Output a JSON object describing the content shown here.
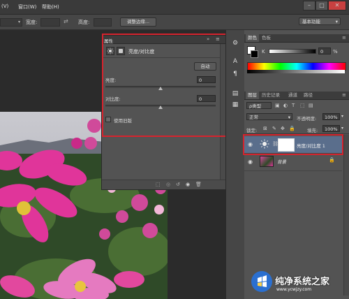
{
  "menubar": {
    "items": [
      "(V)",
      "窗口(W)",
      "帮助(H)"
    ],
    "window_buttons": [
      "–",
      "□",
      "✕"
    ]
  },
  "options_bar": {
    "width_label": "宽度:",
    "height_label": "高度:",
    "refine_edge_label": "调整边缘...",
    "workspace_label": "基本功能",
    "swap_icon": "swap-arrows-icon"
  },
  "properties_panel": {
    "tab_label": "属性",
    "title": "亮度/对比度",
    "auto_button": "自动",
    "brightness_label": "亮度:",
    "brightness_value": "0",
    "contrast_label": "对比度:",
    "contrast_value": "0",
    "legacy_label": "使用旧版",
    "legacy_checked": false,
    "collapse_icon": "double-chevron-right-icon",
    "menu_icon": "panel-menu-icon"
  },
  "color_panel": {
    "tabs": [
      "颜色",
      "色板"
    ],
    "channel_label": "K",
    "value": "0",
    "unit": "%",
    "foreground_color": "#ffffff",
    "background_color": "#000000"
  },
  "layers_panel": {
    "tabs": [
      "图层",
      "历史记录",
      "通道",
      "路径"
    ],
    "kind_filter": "ρ类型",
    "blend_mode": "正常",
    "opacity_label": "不透明度:",
    "opacity_value": "100%",
    "lock_label": "锁定:",
    "fill_label": "填充:",
    "fill_value": "100%",
    "layers": [
      {
        "name": "亮度/对比度 1",
        "selected": true,
        "type": "adjustment"
      },
      {
        "name": "背景",
        "selected": false,
        "type": "image",
        "locked": true
      }
    ]
  },
  "watermark": {
    "text": "纯净系统之家",
    "url": "www.ycwjzy.com"
  },
  "colors": {
    "highlight_red": "#d6232d",
    "selected_layer": "#5a6e8c",
    "ui_bg": "#535353"
  }
}
